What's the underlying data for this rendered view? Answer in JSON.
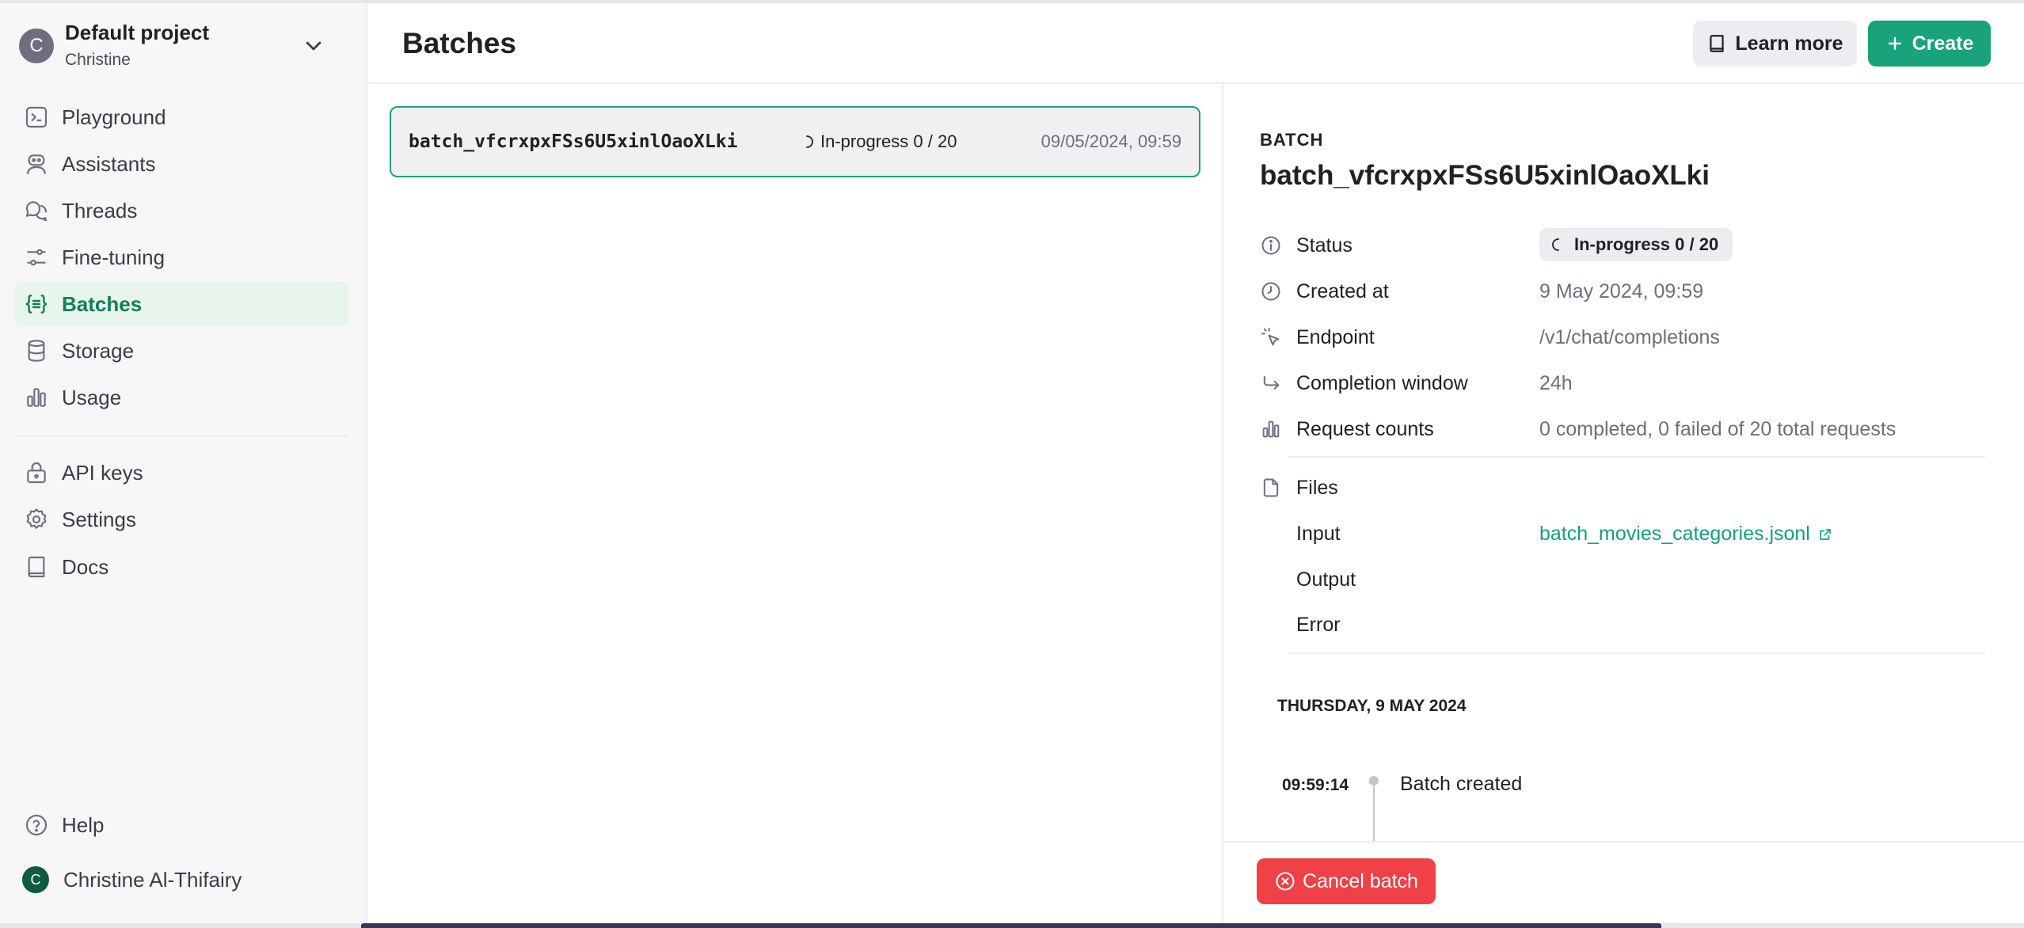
{
  "project": {
    "avatar_letter": "C",
    "name": "Default project",
    "user": "Christine"
  },
  "sidebar": {
    "items": [
      {
        "label": "Playground",
        "icon": "terminal-icon"
      },
      {
        "label": "Assistants",
        "icon": "robot-icon"
      },
      {
        "label": "Threads",
        "icon": "chat-bubbles-icon"
      },
      {
        "label": "Fine-tuning",
        "icon": "sliders-icon"
      },
      {
        "label": "Batches",
        "icon": "braces-list-icon",
        "active": true
      },
      {
        "label": "Storage",
        "icon": "database-icon"
      },
      {
        "label": "Usage",
        "icon": "bar-chart-icon"
      }
    ],
    "items_secondary": [
      {
        "label": "API keys",
        "icon": "lock-icon"
      },
      {
        "label": "Settings",
        "icon": "gear-icon"
      },
      {
        "label": "Docs",
        "icon": "book-icon"
      }
    ],
    "help": {
      "label": "Help",
      "icon": "help-circle-icon"
    },
    "user": {
      "avatar_letter": "C",
      "name": "Christine Al-Thifairy"
    }
  },
  "header": {
    "title": "Batches",
    "learn_more": "Learn more",
    "create": "Create"
  },
  "batches": [
    {
      "id": "batch_vfcrxpxFSs6U5xinlOaoXLki",
      "status": "In-progress 0 / 20",
      "date": "09/05/2024, 09:59"
    }
  ],
  "detail": {
    "kicker": "BATCH",
    "title": "batch_vfcrxpxFSs6U5xinlOaoXLki",
    "status": {
      "label": "Status",
      "value": "In-progress 0 / 20"
    },
    "created": {
      "label": "Created at",
      "value": "9 May 2024, 09:59"
    },
    "endpoint": {
      "label": "Endpoint",
      "value": "/v1/chat/completions"
    },
    "window": {
      "label": "Completion window",
      "value": "24h"
    },
    "counts": {
      "label": "Request counts",
      "value": "0 completed, 0 failed of 20 total requests"
    },
    "files": {
      "label": "Files",
      "input_label": "Input",
      "input_value": "batch_movies_categories.jsonl",
      "output_label": "Output",
      "error_label": "Error"
    },
    "timeline": {
      "day": "THURSDAY, 9 MAY 2024",
      "events": [
        {
          "time": "09:59:14",
          "text": "Batch created"
        }
      ]
    },
    "cancel": "Cancel batch"
  },
  "colors": {
    "accent": "#19a37a",
    "link": "#10a37f",
    "danger": "#ef4146",
    "active_bg": "#e8f5ea"
  }
}
